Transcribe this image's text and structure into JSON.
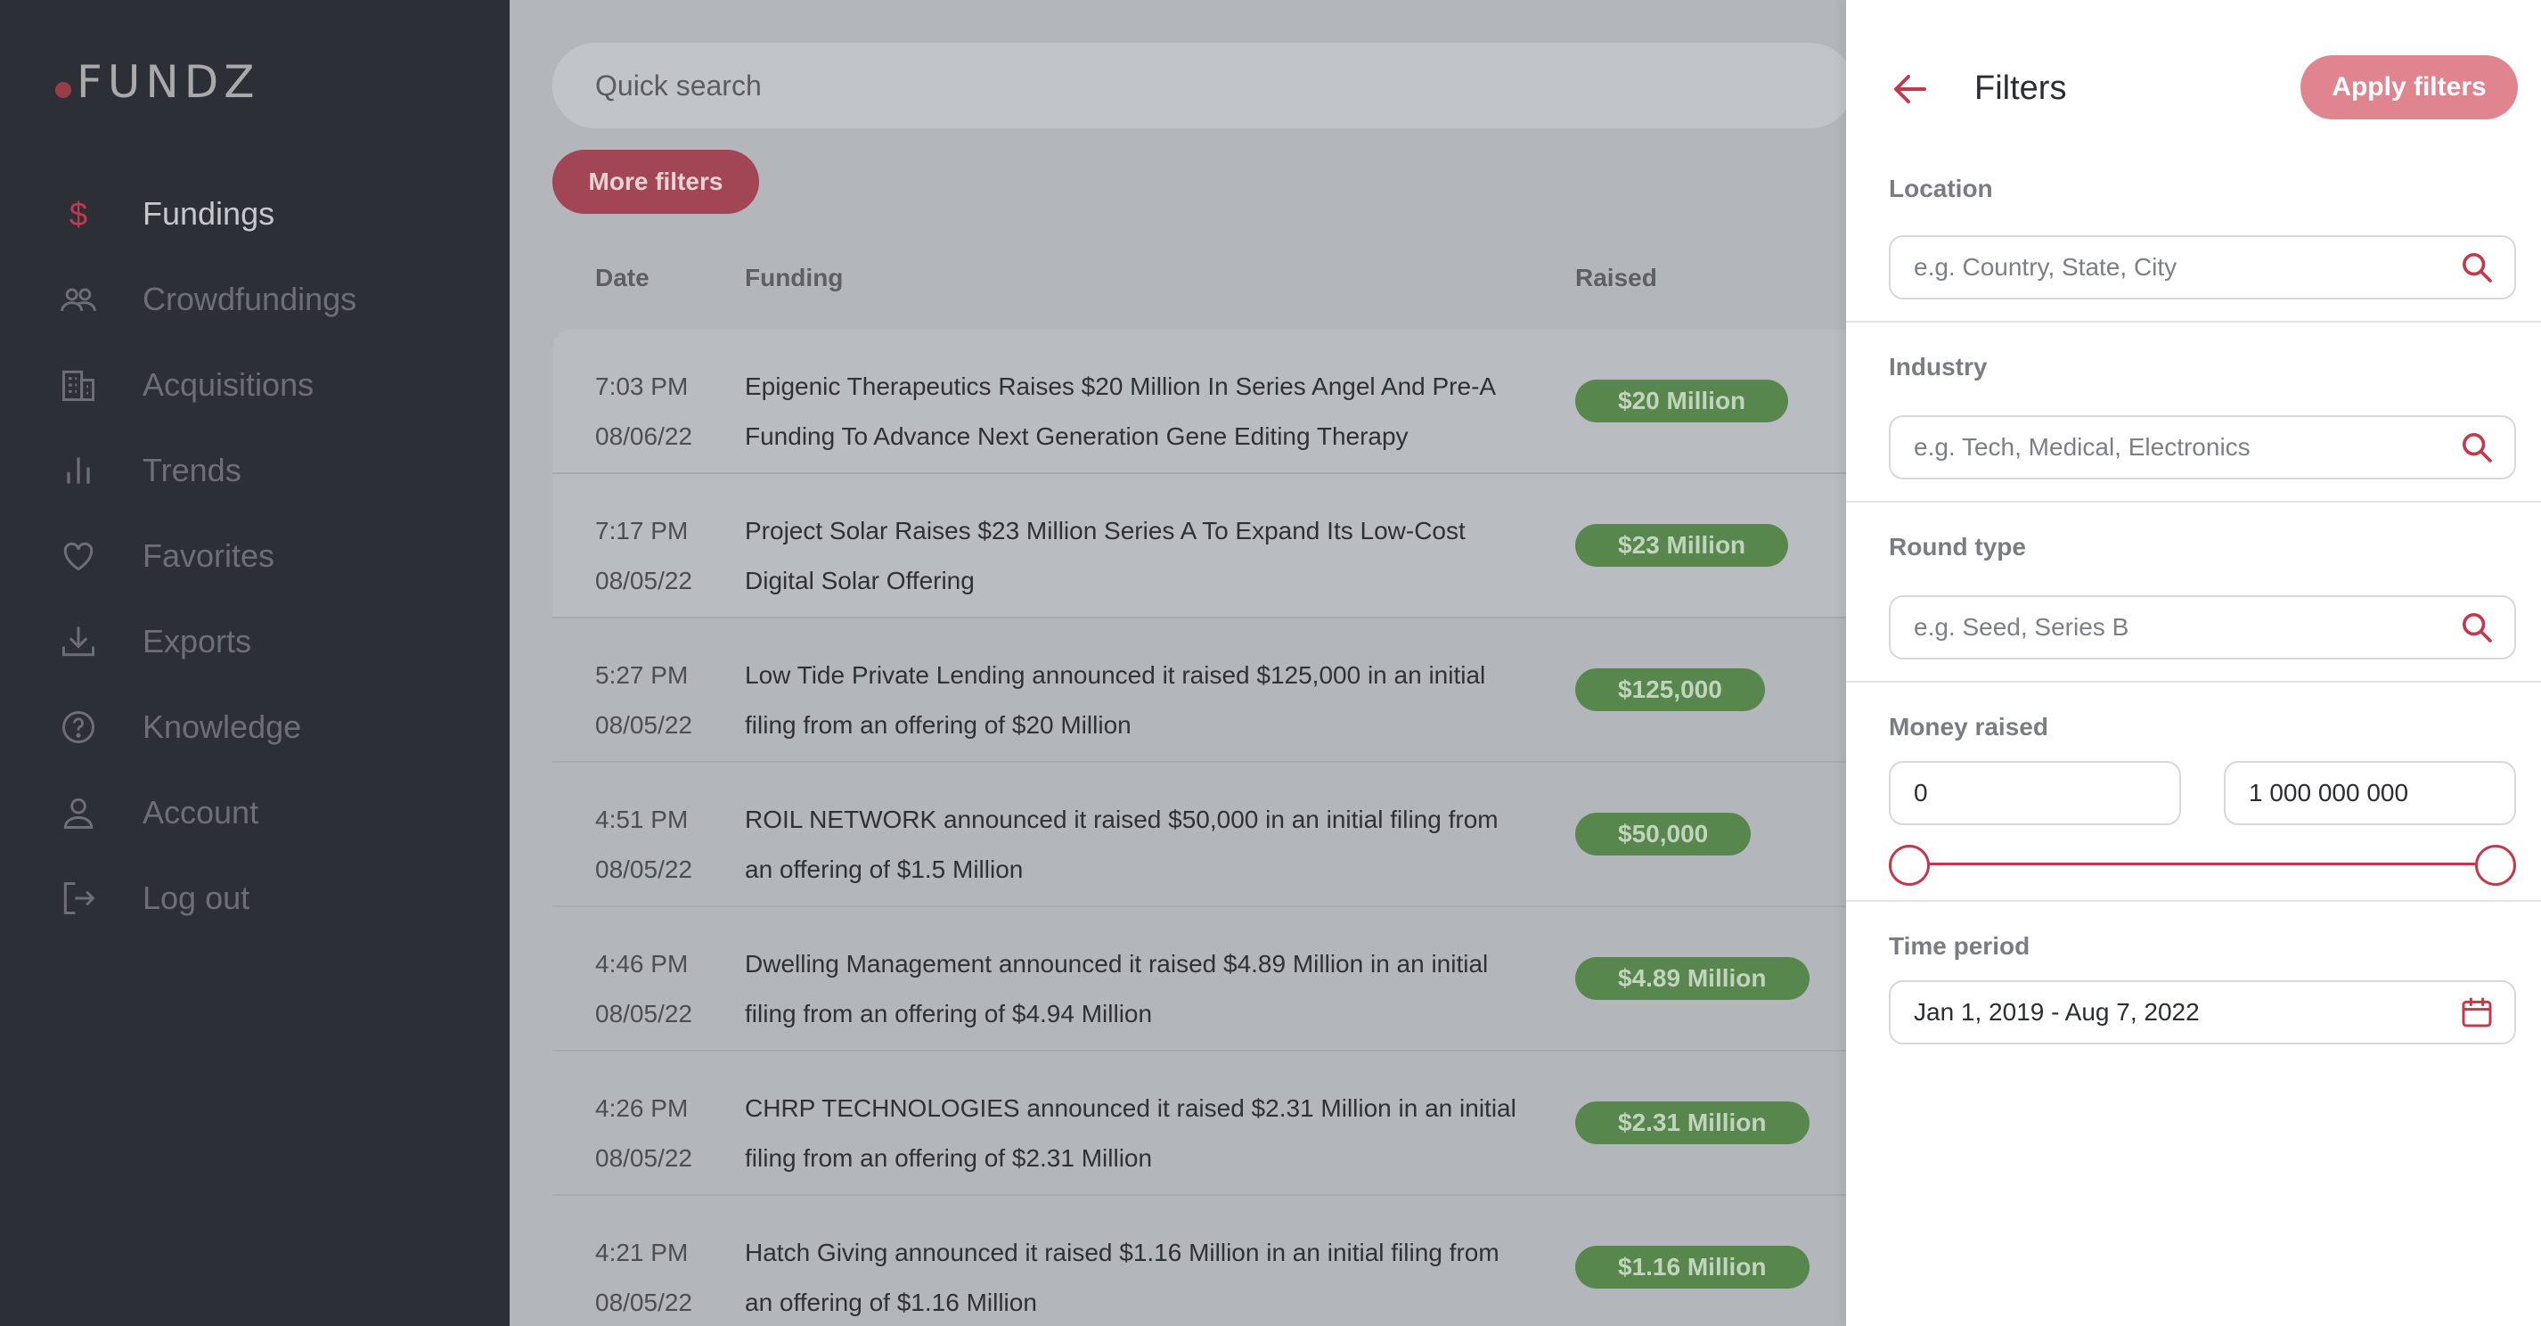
{
  "brand": {
    "name": "FUNDZ"
  },
  "sidebar": {
    "items": [
      {
        "label": "Fundings",
        "icon": "dollar-icon",
        "active": true
      },
      {
        "label": "Crowdfundings",
        "icon": "people-icon"
      },
      {
        "label": "Acquisitions",
        "icon": "building-icon"
      },
      {
        "label": "Trends",
        "icon": "bar-chart-icon"
      },
      {
        "label": "Favorites",
        "icon": "heart-icon"
      },
      {
        "label": "Exports",
        "icon": "download-icon"
      },
      {
        "label": "Knowledge",
        "icon": "help-circle-icon"
      },
      {
        "label": "Account",
        "icon": "user-icon"
      },
      {
        "label": "Log out",
        "icon": "logout-icon"
      }
    ]
  },
  "main": {
    "search_placeholder": "Quick search",
    "more_filters_label": "More filters",
    "columns": {
      "date": "Date",
      "funding": "Funding",
      "raised": "Raised"
    },
    "rows": [
      {
        "time": "7:03 PM",
        "date": "08/06/22",
        "funding_line1": "Epigenic Therapeutics Raises $20 Million In Series Angel And Pre-A",
        "funding_line2": "Funding To Advance Next Generation Gene Editing Therapy",
        "raised": "$20 Million"
      },
      {
        "time": "7:17 PM",
        "date": "08/05/22",
        "funding_line1": "Project Solar Raises $23 Million Series A To Expand Its Low-Cost",
        "funding_line2": "Digital Solar Offering",
        "raised": "$23 Million"
      },
      {
        "time": "5:27 PM",
        "date": "08/05/22",
        "funding_line1": "Low Tide Private Lending announced it raised $125,000 in an initial",
        "funding_line2": "filing from an offering of $20 Million",
        "raised": "$125,000"
      },
      {
        "time": "4:51 PM",
        "date": "08/05/22",
        "funding_line1": "ROIL NETWORK announced it raised $50,000 in an initial filing from",
        "funding_line2": "an offering of $1.5 Million",
        "raised": "$50,000"
      },
      {
        "time": "4:46 PM",
        "date": "08/05/22",
        "funding_line1": "Dwelling Management announced it raised $4.89 Million in an initial",
        "funding_line2": "filing from an offering of $4.94 Million",
        "raised": "$4.89 Million"
      },
      {
        "time": "4:26 PM",
        "date": "08/05/22",
        "funding_line1": "CHRP TECHNOLOGIES announced it raised $2.31 Million in an initial",
        "funding_line2": "filing from an offering of $2.31 Million",
        "raised": "$2.31 Million"
      },
      {
        "time": "4:21 PM",
        "date": "08/05/22",
        "funding_line1": "Hatch Giving announced it raised $1.16 Million in an initial filing from",
        "funding_line2": "an offering of $1.16 Million",
        "raised": "$1.16 Million"
      }
    ]
  },
  "filters": {
    "title": "Filters",
    "apply_label": "Apply filters",
    "location": {
      "label": "Location",
      "placeholder": "e.g. Country, State, City"
    },
    "industry": {
      "label": "Industry",
      "placeholder": "e.g. Tech, Medical, Electronics"
    },
    "round_type": {
      "label": "Round type",
      "placeholder": "e.g. Seed, Series B"
    },
    "money_raised": {
      "label": "Money raised",
      "min": "0",
      "max": "1 000 000 000"
    },
    "time_period": {
      "label": "Time period",
      "value": "Jan 1, 2019 - Aug 7, 2022"
    }
  },
  "colors": {
    "accent": "#c5384c",
    "sidebar_bg": "#2d2f36",
    "badge_green": "#58874e"
  }
}
